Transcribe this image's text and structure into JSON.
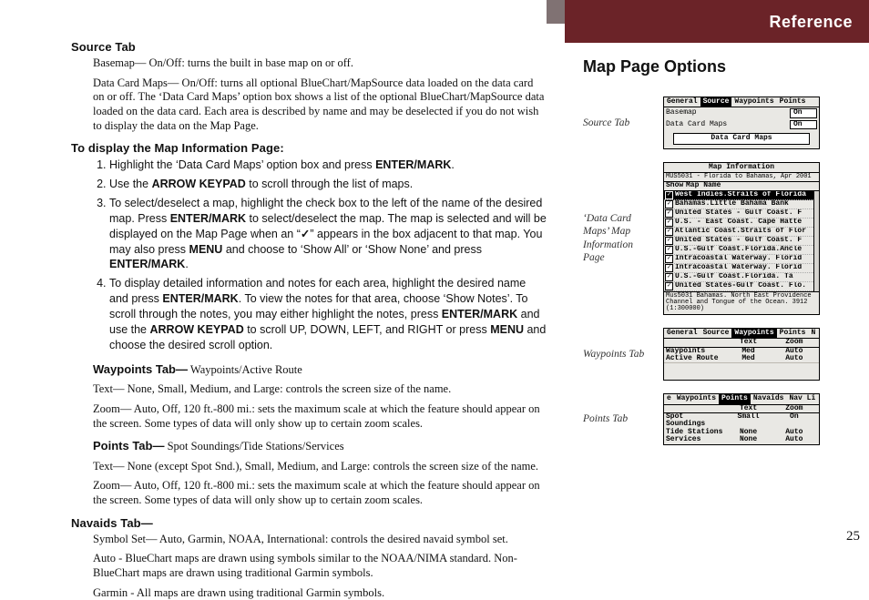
{
  "left": {
    "source_tab_heading": "Source Tab",
    "source_basemap": "Basemap— On/Off: turns the built in base map on or off.",
    "source_datacard": "Data Card Maps— On/Off: turns all optional BlueChart/MapSource data loaded on the data card on or off. The ‘Data Card Maps’ option box shows a list of the optional BlueChart/MapSource data loaded on the data card. Each area is described by name and may be deselected if you do not wish to display the data on the Map Page.",
    "display_heading": "To display the Map Information Page:",
    "steps": [
      "Highlight the ‘Data Card Maps’ option box and press <b>ENTER/MARK</b>.",
      "Use the <b>ARROW KEYPAD</b> to scroll through the list of maps.",
      "To select/deselect a map, highlight the check box to the left of the name of the desired map. Press <b>ENTER/MARK</b> to select/deselect the map. The map is selected and will be displayed on the Map Page when an “<span class=\"check\">✓</span>” appears in the box adjacent to that map. You may also press <b>MENU</b> and choose to ‘Show All’ or ‘Show None’ and press <b>ENTER/MARK</b>.",
      "To display detailed information and notes for each area, highlight the desired name and press <b>ENTER/MARK</b>. To view the notes for that area, choose ‘Show Notes’. To scroll through the notes, you may either highlight the notes, press <b>ENTER/MARK</b> and use the <b>ARROW KEYPAD</b> to scroll UP, DOWN, LEFT, and RIGHT or press <b>MENU</b> and choose the desired scroll option."
    ],
    "waypoints_label": "Waypoints Tab—",
    "waypoints_sub": "  Waypoints/Active Route",
    "waypoints_text": "Text— None, Small, Medium, and Large: controls the screen size of the name.",
    "waypoints_zoom": "Zoom— Auto, Off, 120 ft.-800 mi.: sets the maximum scale at which the feature should appear on the screen. Some types of data will only show up to certain zoom scales.",
    "points_label": "Points Tab—",
    "points_sub": "  Spot Soundings/Tide Stations/Services",
    "points_text": "Text— None (except Spot Snd.), Small, Medium, and Large: controls the screen size of the name.",
    "points_zoom": "Zoom— Auto, Off, 120 ft.-800 mi.: sets the maximum scale at which the feature should appear on the screen. Some types of data will only show up to certain zoom scales.",
    "navaids_heading": "Navaids Tab—",
    "navaids_symbolset": "Symbol Set— Auto, Garmin, NOAA, International: controls the desired navaid symbol set.",
    "navaids_auto": "Auto - BlueChart maps are drawn using symbols similar to the NOAA/NIMA standard. Non-BlueChart maps are drawn using traditional Garmin symbols.",
    "navaids_garmin": "Garmin - All maps are drawn using traditional Garmin symbols."
  },
  "right": {
    "reference": "Reference",
    "subheading": "Map Page Options",
    "page_no": "25",
    "caps": {
      "source": "Source Tab",
      "mapinfo": "‘Data Card Maps’ Map Information Page",
      "waypoints": "Waypoints Tab",
      "points": "Points Tab"
    },
    "scr_source": {
      "tabs": [
        "General",
        "Source",
        "Waypoints",
        "Points"
      ],
      "selected_tab": 1,
      "rows": [
        {
          "k": "Basemap",
          "v": "On"
        },
        {
          "k": "Data Card Maps",
          "v": "On"
        }
      ],
      "button": "Data Card Maps"
    },
    "scr_mapinfo": {
      "title": "Map Information",
      "subtitle": "MUS5031 - Florida to Bahamas, Apr 2001",
      "show_label": "Show",
      "name_label": "Map Name",
      "maps": [
        "West Indies.Straits of Florida",
        "Bahamas.Little Bahama Bank",
        "United States - Gulf Coast. F",
        "U.S. - East Coast. Cape Hatte",
        "Atlantic Coast.Straits of Flor",
        "United States - Gulf Coast. F",
        "U.S.-Gulf Coast.Florida.Ancle",
        "Intracoastal Waterway. Florid",
        "Intracoastal Waterway. Florid",
        "U.S.-Gulf Coast.Florida. Ta",
        "United States-Gulf Coast. Flo."
      ],
      "footnote": "Mus5031 Bahamas. North East Providence Channel and Tongue of the Ocean. 3912 (1:300000)"
    },
    "scr_waypoints": {
      "tabs": [
        "General",
        "Source",
        "Waypoints",
        "Points",
        "N"
      ],
      "selected_tab": 2,
      "cols": [
        "",
        "Text",
        "Zoom"
      ],
      "rows": [
        {
          "name": "Waypoints",
          "text": "Med",
          "zoom": "Auto"
        },
        {
          "name": "Active Route",
          "text": "Med",
          "zoom": "Auto"
        }
      ]
    },
    "scr_points": {
      "tabs": [
        "e",
        "Waypoints",
        "Points",
        "Navaids",
        "Nav Li"
      ],
      "selected_tab": 2,
      "cols": [
        "",
        "Text",
        "Zoom"
      ],
      "rows": [
        {
          "name": "Spot Soundings",
          "text": "Small",
          "zoom": "On"
        },
        {
          "name": "Tide Stations",
          "text": "None",
          "zoom": "Auto"
        },
        {
          "name": "Services",
          "text": "None",
          "zoom": "Auto"
        }
      ]
    }
  }
}
